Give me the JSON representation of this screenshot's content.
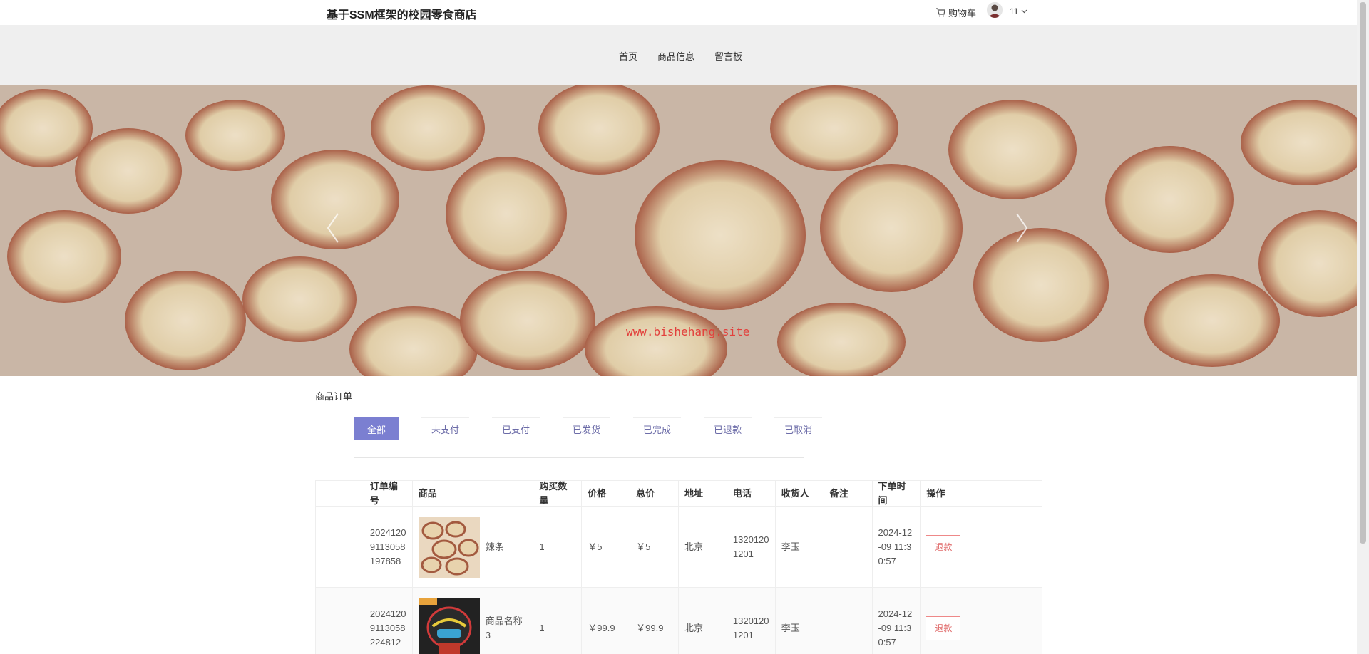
{
  "header": {
    "site_title": "基于SSM框架的校园零食商店",
    "cart_label": "购物车",
    "username": "11"
  },
  "nav": {
    "items": [
      "首页",
      "商品信息",
      "留言板"
    ]
  },
  "banner": {
    "watermark": "www.bishehang.site"
  },
  "orders": {
    "section_title": "商品订单",
    "tabs": [
      "全部",
      "未支付",
      "已支付",
      "已发货",
      "已完成",
      "已退款",
      "已取消"
    ],
    "active_tab": "全部",
    "columns": [
      "",
      "订单编号",
      "商品",
      "购买数量",
      "价格",
      "总价",
      "地址",
      "电话",
      "收货人",
      "备注",
      "下单时间",
      "操作"
    ],
    "rows": [
      {
        "order_no": "20241209113058197858",
        "product_name": "辣条",
        "quantity": "1",
        "price": "￥5",
        "total": "￥5",
        "address": "北京",
        "phone": "13201201201",
        "receiver": "李玉",
        "note": "",
        "order_time": "2024-12-09 11:30:57",
        "action": "退款"
      },
      {
        "order_no": "20241209113058224812",
        "product_name": "商品名称3",
        "quantity": "1",
        "price": "￥99.9",
        "total": "￥99.9",
        "address": "北京",
        "phone": "13201201201",
        "receiver": "李玉",
        "note": "",
        "order_time": "2024-12-09 11:30:57",
        "action": "退款"
      }
    ]
  }
}
